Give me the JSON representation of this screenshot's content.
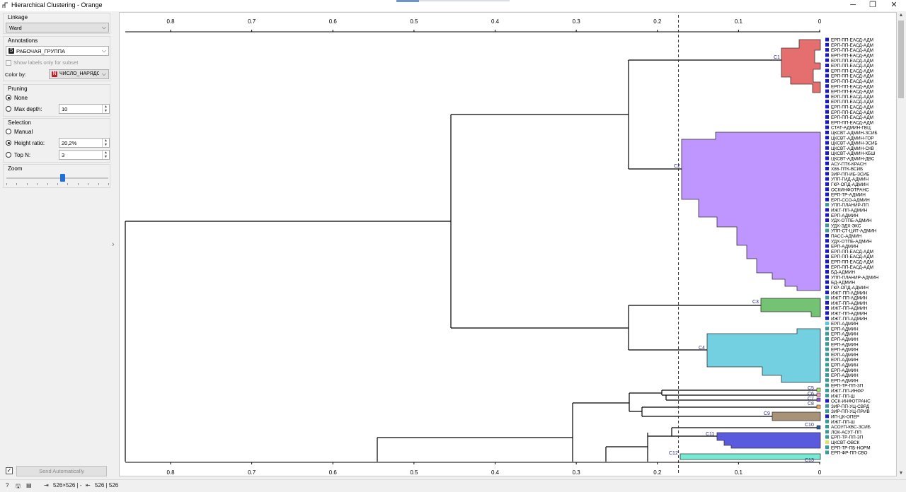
{
  "window": {
    "title": "Hierarchical Clustering - Orange"
  },
  "linkage": {
    "label": "Linkage",
    "value": "Ward"
  },
  "annotations": {
    "label": "Annotations",
    "value": "РАБОЧАЯ_ГРУППА",
    "value_icon": "S",
    "subset_label": "Show labels only for subset",
    "color_by_label": "Color by:",
    "color_by_value": "ЧИСЛО_НАРЯДОВ_ПО_ЗА",
    "color_by_icon": "N"
  },
  "pruning": {
    "label": "Pruning",
    "none_label": "None",
    "max_depth_label": "Max depth:",
    "max_depth_value": "10",
    "selected": "None"
  },
  "selection": {
    "label": "Selection",
    "manual_label": "Manual",
    "height_ratio_label": "Height ratio:",
    "height_ratio_value": "20,2%",
    "top_n_label": "Top N:",
    "top_n_value": "3",
    "selected": "Height ratio"
  },
  "zoom": {
    "label": "Zoom",
    "level": 0.55
  },
  "send": {
    "label": "Send Automatically",
    "checked": true
  },
  "status": {
    "in_label": "526×526 | -",
    "out_label": "526 | 526"
  },
  "axis": {
    "ticks": [
      "0.8",
      "0.7",
      "0.6",
      "0.5",
      "0.4",
      "0.3",
      "0.2",
      "0.1",
      "0"
    ],
    "cutoff": 0.174
  },
  "clusters": [
    {
      "name": "C1",
      "color": "#e05555"
    },
    {
      "name": "C2",
      "color": "#b483ff"
    },
    {
      "name": "C3",
      "color": "#5cb85c"
    },
    {
      "name": "C4",
      "color": "#5bc8dc"
    },
    {
      "name": "C5",
      "color": "#b5e46e"
    },
    {
      "name": "C6",
      "color": "#f0a0c8"
    },
    {
      "name": "C7",
      "color": "#8855cc"
    },
    {
      "name": "C8",
      "color": "#f0a860"
    },
    {
      "name": "C9",
      "color": "#9a8060"
    },
    {
      "name": "C10",
      "color": "#2a5a9a"
    },
    {
      "name": "C11",
      "color": "#3d3dd8"
    },
    {
      "name": "C12",
      "color": "#5ee8cc"
    },
    {
      "name": "C13",
      "color": "#aaaaaa"
    }
  ],
  "leaves": [
    {
      "label": "ЕРП-ПП-ЕАСД-АДМ",
      "color": "#1a1ac8"
    },
    {
      "label": "ЕРП-ПП-ЕАСД-АДМ",
      "color": "#1a1ac8"
    },
    {
      "label": "ЕРП-ПП-ЕАСД-АДМ",
      "color": "#1a1ac8"
    },
    {
      "label": "ЕРП-ПП-ЕАСД-АДМ",
      "color": "#1a1ac8"
    },
    {
      "label": "ЕРП-ПП-ЕАСД-АДМ",
      "color": "#1a1ac8"
    },
    {
      "label": "ЕРП-ПП-ЕАСД-АДМ",
      "color": "#1a1ac8"
    },
    {
      "label": "ЕРП-ПП-ЕАСД-АДМ",
      "color": "#1a1ac8"
    },
    {
      "label": "ЕРП-ПП-ЕАСД-АДМ",
      "color": "#1a1ac8"
    },
    {
      "label": "ЕРП-ПП-ЕАСД-АДМ",
      "color": "#1a1ac8"
    },
    {
      "label": "ЕРП-ПП-ЕАСД-АДМ",
      "color": "#1a1ac8"
    },
    {
      "label": "ЕРП-ПП-ЕАСД-АДМ",
      "color": "#1a1ac8"
    },
    {
      "label": "ЕРП-ПП-ЕАСД-АДМ",
      "color": "#1a1ac8"
    },
    {
      "label": "ЕРП-ПП-ЕАСД-АДМ",
      "color": "#1a1ac8"
    },
    {
      "label": "ЕРП-ПП-ЕАСД-АДМ",
      "color": "#1a1ac8"
    },
    {
      "label": "ЕРП-ПП-ЕАСД-АДМ",
      "color": "#1a1ac8"
    },
    {
      "label": "ЕРП-ПП-ЕАСД-АДМ",
      "color": "#1a1ac8"
    },
    {
      "label": "ЕРП-ПП-ЕАСД-АДМ",
      "color": "#1a1ac8"
    },
    {
      "label": "СТАТ-АДМИН-ГВЦ",
      "color": "#1a1ac8"
    },
    {
      "label": "ЦКСВТ-АДМИН-ЗСИБ",
      "color": "#1a1ac8"
    },
    {
      "label": "ЦКСВТ-АДМИН-ГОР",
      "color": "#1a1ac8"
    },
    {
      "label": "ЦКСВТ-АДМИН-ЗСИБ",
      "color": "#1a1ac8"
    },
    {
      "label": "ЦКСВТ-АДМИН-СКВ",
      "color": "#1a1ac8"
    },
    {
      "label": "ЦКСВТ-АДМИН-КБШ",
      "color": "#1a1ac8"
    },
    {
      "label": "ЦКСВТ-АДМИН-ДВС",
      "color": "#1a1ac8"
    },
    {
      "label": "АСУ-ПТК-КРАСН",
      "color": "#1a1ac8"
    },
    {
      "label": "Х86-ПТК-ВСИБ",
      "color": "#1a1ac8"
    },
    {
      "label": "ЗИР-ПП-ИБ-ЗСИБ",
      "color": "#1a1ac8"
    },
    {
      "label": "УПП-ГИД-АДМИН",
      "color": "#1a1ac8"
    },
    {
      "label": "ГКР-ОПД-АДМИН",
      "color": "#1a1ac8"
    },
    {
      "label": "ОСКИНФОТРАНС",
      "color": "#1a1ac8"
    },
    {
      "label": "ЕРП-ТР-АДМИН",
      "color": "#1a1ac8"
    },
    {
      "label": "ЕРП-ССО-АДМИН",
      "color": "#1a1ac8"
    },
    {
      "label": "УПП-ПЛАНИР-ПП",
      "color": "#3a9a9a"
    },
    {
      "label": "ИЖТ-ПП-АДМИН",
      "color": "#1a1ac8"
    },
    {
      "label": "ЕРП-АДМИН",
      "color": "#1a1ac8"
    },
    {
      "label": "УДХ-ОТПБ-АДМИН",
      "color": "#1a1ac8"
    },
    {
      "label": "УДХ-ЭДХ-ЭКС",
      "color": "#3a9a9a"
    },
    {
      "label": "УПП-СТ-ЦИТ-АДМИН",
      "color": "#3a9a9a"
    },
    {
      "label": "ПАСС-АДМИН",
      "color": "#1a1ac8"
    },
    {
      "label": "УДХ-ОТПБ-АДМИН",
      "color": "#1a1ac8"
    },
    {
      "label": "ЕРП-АДМИН",
      "color": "#1a1ac8"
    },
    {
      "label": "ЕРП-ПП-ЕАСД-АДМ",
      "color": "#1a1ac8"
    },
    {
      "label": "ЕРП-ПП-ЕАСД-АДМ",
      "color": "#1a1ac8"
    },
    {
      "label": "ЕРП-ПП-ЕАСД-АДМ",
      "color": "#1a1ac8"
    },
    {
      "label": "ЕРП-ПП-ЕАСД-АДМ",
      "color": "#1a1ac8"
    },
    {
      "label": "БД-АДМИН",
      "color": "#1a1ac8"
    },
    {
      "label": "УПП-ПЛАНИР-АДМИН",
      "color": "#1a1ac8"
    },
    {
      "label": "БД-АДМИН",
      "color": "#1a1ac8"
    },
    {
      "label": "ГКР-ОПД-АДМИН",
      "color": "#1a1ac8"
    },
    {
      "label": "ИЖТ-ПП-АДМИН",
      "color": "#1a1ac8"
    },
    {
      "label": "ИЖТ-ПП-АДМИН",
      "color": "#3a9a9a"
    },
    {
      "label": "ИЖТ-ПП-АДМИН",
      "color": "#1a1ac8"
    },
    {
      "label": "ИЖТ-ПП-АДМИН",
      "color": "#1a1ac8"
    },
    {
      "label": "ИЖТ-ПП-АДМИН",
      "color": "#1a1ac8"
    },
    {
      "label": "ИЖТ-ПП-АДМИН",
      "color": "#1a1ac8"
    },
    {
      "label": "ЕРП-АДМИН",
      "color": "#5bc8dc"
    },
    {
      "label": "ЕРП-АДМИН",
      "color": "#3a9a9a"
    },
    {
      "label": "ЕРП-АДМИН",
      "color": "#3a9a9a"
    },
    {
      "label": "ЕРП-АДМИН",
      "color": "#3a9a9a"
    },
    {
      "label": "ЕРП-АДМИН",
      "color": "#3a9a9a"
    },
    {
      "label": "ЕРП-АДМИН",
      "color": "#3a9a9a"
    },
    {
      "label": "ЕРП-АДМИН",
      "color": "#3a9a9a"
    },
    {
      "label": "ЕРП-АДМИН",
      "color": "#3a9a9a"
    },
    {
      "label": "ЕРП-АДМИН",
      "color": "#3a9a9a"
    },
    {
      "label": "ЕРП-АДМИН",
      "color": "#3a9a9a"
    },
    {
      "label": "ЕРП-АДМИН",
      "color": "#3a9a9a"
    },
    {
      "label": "ЕРП-АДМИН",
      "color": "#3a9a9a"
    },
    {
      "label": "ЕРП-ТР-ПП-ЗП",
      "color": "#3a9a9a"
    },
    {
      "label": "ИЖТ-ПП-ИНФР",
      "color": "#3a9a9a"
    },
    {
      "label": "ИЖТ-ПП-Ш",
      "color": "#3a9a9a"
    },
    {
      "label": "ОСК-ИНФОТРАНС",
      "color": "#1a1ac8"
    },
    {
      "label": "ЗИР-ПП-УЦ-СВРД",
      "color": "#3a9a9a"
    },
    {
      "label": "ЗИР-ПП-УЦ-ПРИВ",
      "color": "#3a9a9a"
    },
    {
      "label": "ИП-ЦК-ОПЕР",
      "color": "#1a1ac8"
    },
    {
      "label": "ИЖТ-ПП-Ш",
      "color": "#3a9a9a"
    },
    {
      "label": "АСОУП-КВС-ЗСИБ",
      "color": "#3a9a9a"
    },
    {
      "label": "ЛОК-АСУТ-ПП",
      "color": "#3a9a9a"
    },
    {
      "label": "ЕРП-ТР-ПП-ЗП",
      "color": "#3a9a9a"
    },
    {
      "label": "ЦКСВТ-ОВСК",
      "color": "#e0e060"
    },
    {
      "label": "ЕРП-ТР-ПБ-НОРМ",
      "color": "#3a9a9a"
    },
    {
      "label": "ЕРП-ФР-ПП-СВО",
      "color": "#3a9a9a"
    }
  ]
}
